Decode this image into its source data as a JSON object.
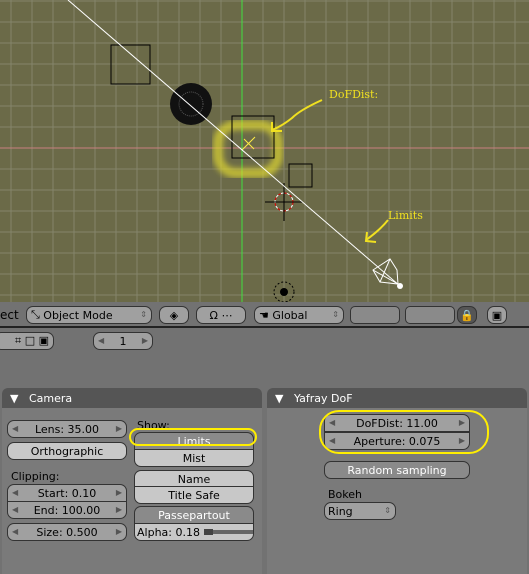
{
  "viewport": {
    "annotations": {
      "dof": "DoFDist:",
      "limits": "Limits"
    },
    "colors": {
      "background": "#6b6a48",
      "x_axis": "#d08080",
      "y_axis": "#40e040",
      "highlight": "#ffee00"
    }
  },
  "header": {
    "menu_partial": "ect",
    "mode": "Object Mode",
    "orientation": "Global",
    "icons": [
      "object-mode-icon",
      "shading-icon",
      "pivot-icon",
      "hand-icon",
      "layers",
      "lock-icon",
      "render-icon"
    ]
  },
  "buttons_header": {
    "frame": "1"
  },
  "camera": {
    "title": "Camera",
    "lens": "Lens: 35.00",
    "ortho": "Orthographic",
    "clipping_label": "Clipping:",
    "start": "Start: 0.10",
    "end": "End: 100.00",
    "size": "Size: 0.500",
    "show_label": "Show:",
    "limits": "Limits",
    "mist": "Mist",
    "name": "Name",
    "title_safe": "Title Safe",
    "passepartout": "Passepartout",
    "alpha": "Alpha: 0.18",
    "alpha_value": 0.18
  },
  "yafray": {
    "title": "Yafray DoF",
    "dofdist": "DoFDist: 11.00",
    "aperture": "Aperture: 0.075",
    "random": "Random sampling",
    "bokeh_label": "Bokeh",
    "bokeh": "Ring"
  }
}
